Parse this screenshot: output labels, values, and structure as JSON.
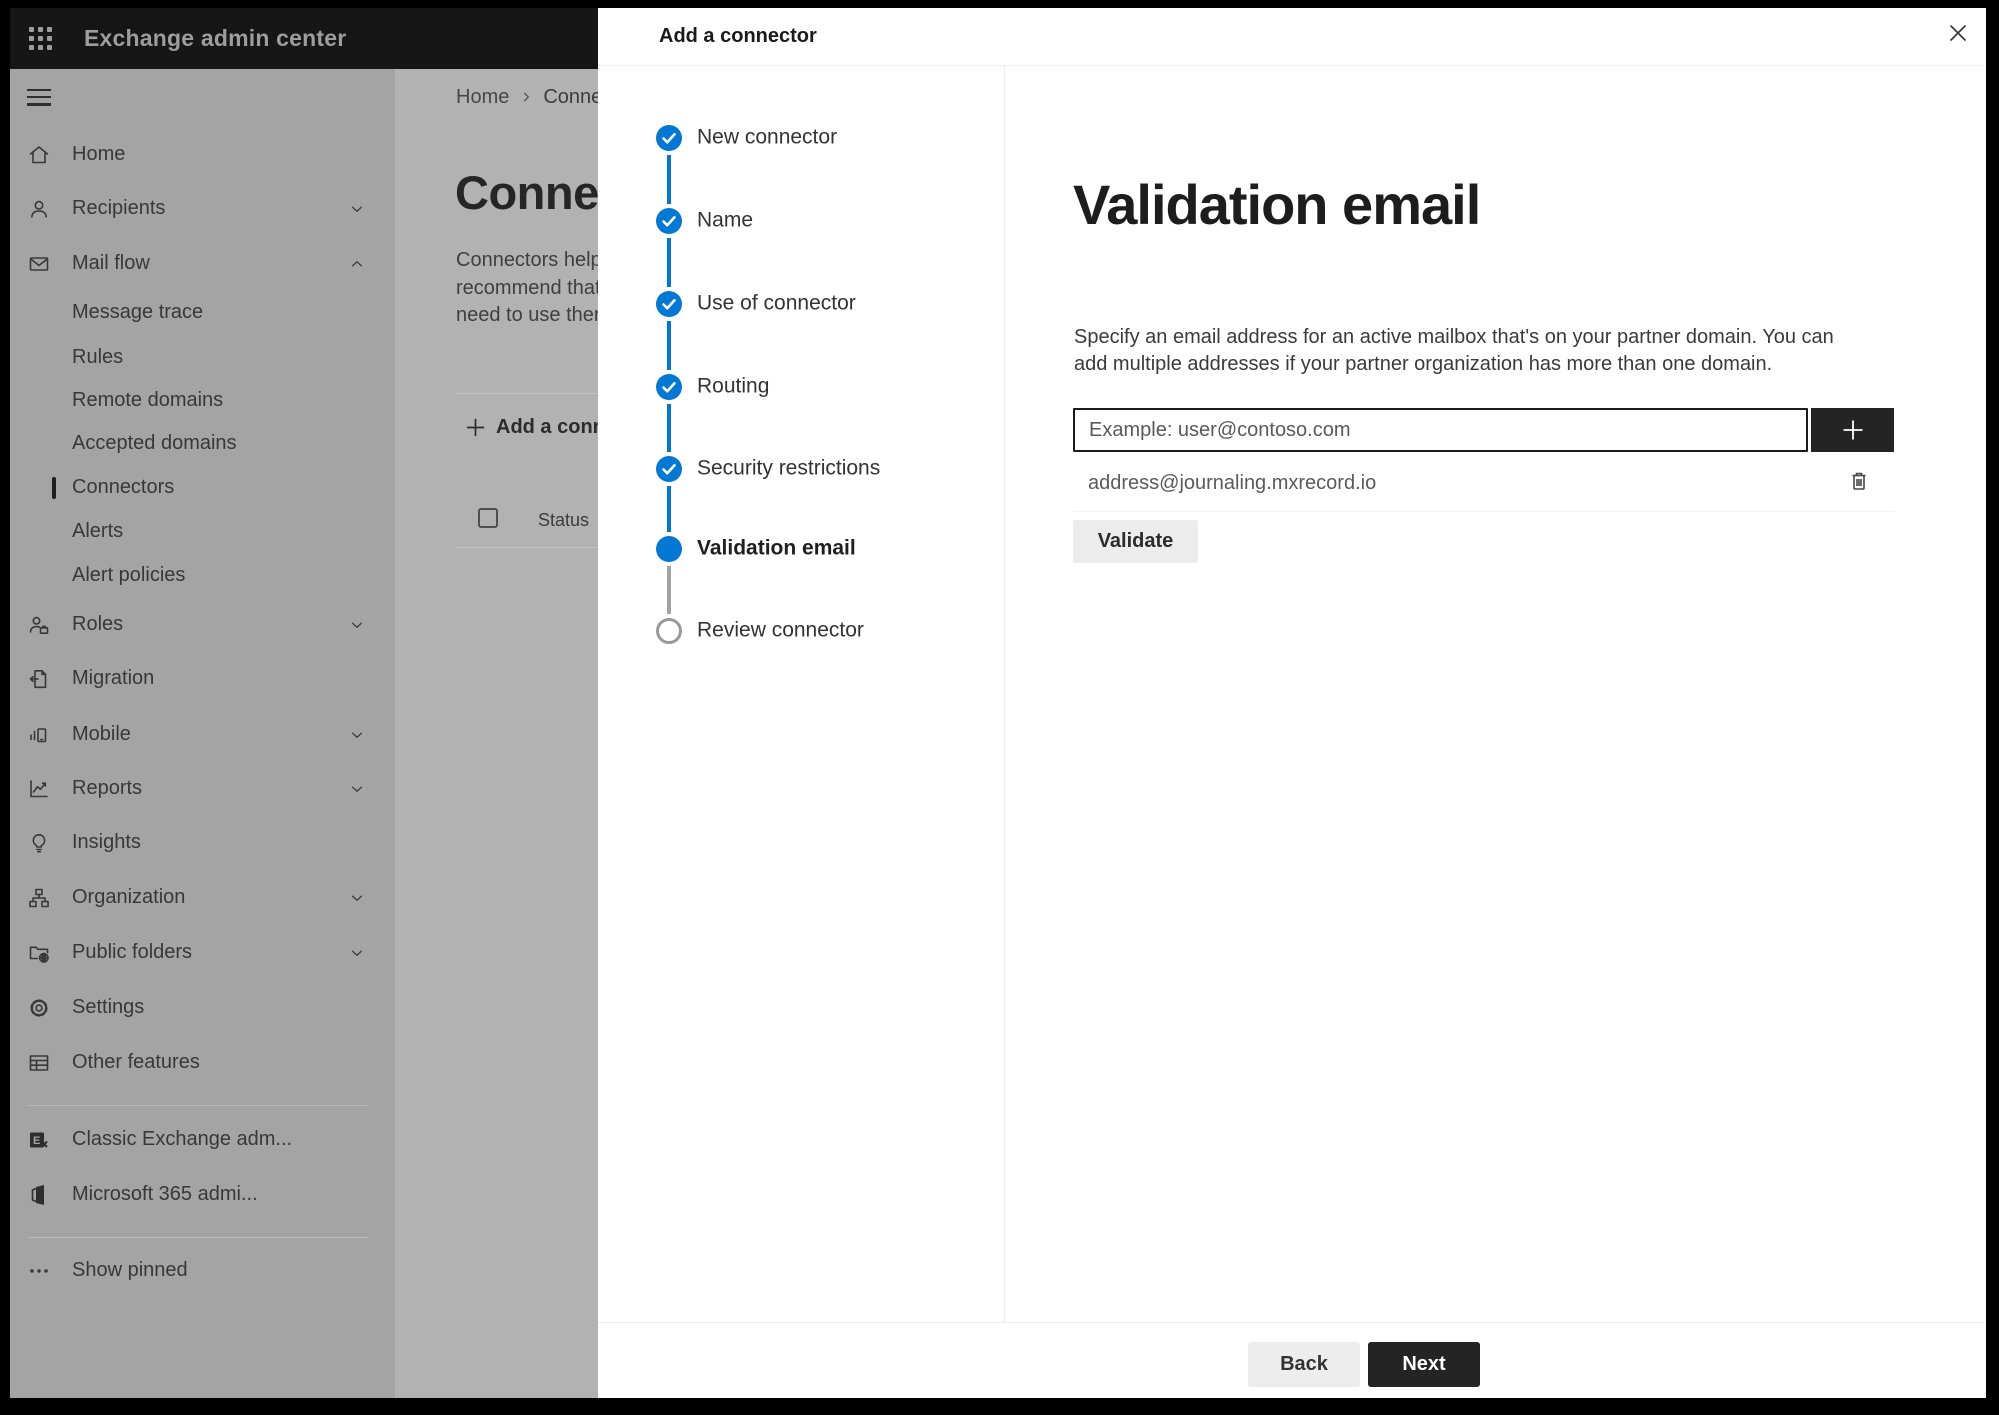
{
  "colors": {
    "accent": "#0078d4",
    "topbar_bg": "#161616",
    "sidebar_bg": "#a4a4a4",
    "page_bg": "#b2b2b2",
    "panel_bg": "#ffffff",
    "dark_button_bg": "#242424"
  },
  "topbar": {
    "app_launcher_icon": "waffle-icon",
    "title": "Exchange admin center"
  },
  "sidebar": {
    "menu_icon": "hamburger-icon",
    "items": [
      {
        "label": "Home",
        "icon": "home-icon",
        "type": "top"
      },
      {
        "label": "Recipients",
        "icon": "person-icon",
        "type": "top",
        "chevron": "down"
      },
      {
        "label": "Mail flow",
        "icon": "mail-icon",
        "type": "top",
        "chevron": "up",
        "expanded": true
      },
      {
        "label": "Message trace",
        "type": "sub"
      },
      {
        "label": "Rules",
        "type": "sub"
      },
      {
        "label": "Remote domains",
        "type": "sub"
      },
      {
        "label": "Accepted domains",
        "type": "sub"
      },
      {
        "label": "Connectors",
        "type": "sub",
        "selected": true
      },
      {
        "label": "Alerts",
        "type": "sub"
      },
      {
        "label": "Alert policies",
        "type": "sub"
      },
      {
        "label": "Roles",
        "icon": "roles-icon",
        "type": "top",
        "chevron": "down"
      },
      {
        "label": "Migration",
        "icon": "migration-icon",
        "type": "top"
      },
      {
        "label": "Mobile",
        "icon": "mobile-icon",
        "type": "top",
        "chevron": "down"
      },
      {
        "label": "Reports",
        "icon": "reports-icon",
        "type": "top",
        "chevron": "down"
      },
      {
        "label": "Insights",
        "icon": "insights-icon",
        "type": "top"
      },
      {
        "label": "Organization",
        "icon": "organization-icon",
        "type": "top",
        "chevron": "down"
      },
      {
        "label": "Public folders",
        "icon": "public-folders-icon",
        "type": "top",
        "chevron": "down"
      },
      {
        "label": "Settings",
        "icon": "settings-icon",
        "type": "top"
      },
      {
        "label": "Other features",
        "icon": "other-features-icon",
        "type": "top",
        "divider_after": true
      },
      {
        "label": "Classic Exchange adm...",
        "icon": "classic-exchange-icon",
        "type": "top"
      },
      {
        "label": "Microsoft 365 admi...",
        "icon": "m365-icon",
        "type": "top",
        "divider_after": true
      },
      {
        "label": "Show pinned",
        "icon": "ellipsis-icon",
        "type": "top"
      }
    ]
  },
  "page": {
    "breadcrumb": {
      "home": "Home",
      "separator": "›",
      "current": "Conne"
    },
    "title": "Connec",
    "description_lines": [
      "Connectors help",
      "recommend that",
      "need to use ther"
    ],
    "add_button": {
      "label": "Add a conn",
      "icon": "plus-icon"
    },
    "table": {
      "header": "Status"
    }
  },
  "panel": {
    "title": "Add a connector",
    "close_icon": "close-icon",
    "steps": [
      {
        "label": "New connector",
        "state": "done"
      },
      {
        "label": "Name",
        "state": "done"
      },
      {
        "label": "Use of connector",
        "state": "done"
      },
      {
        "label": "Routing",
        "state": "done"
      },
      {
        "label": "Security restrictions",
        "state": "done"
      },
      {
        "label": "Validation email",
        "state": "current"
      },
      {
        "label": "Review connector",
        "state": "todo"
      }
    ],
    "content": {
      "heading": "Validation email",
      "description": "Specify an email address for an active mailbox that's on your partner domain. You can add multiple addresses if your partner organization has more than one domain.",
      "email_input": {
        "placeholder": "Example: user@contoso.com",
        "value": ""
      },
      "add_address_icon": "plus-icon",
      "addresses": [
        {
          "email": "address@journaling.mxrecord.io",
          "delete_icon": "trash-icon"
        }
      ],
      "validate_button": "Validate"
    },
    "footer": {
      "back_button": "Back",
      "next_button": "Next"
    }
  }
}
